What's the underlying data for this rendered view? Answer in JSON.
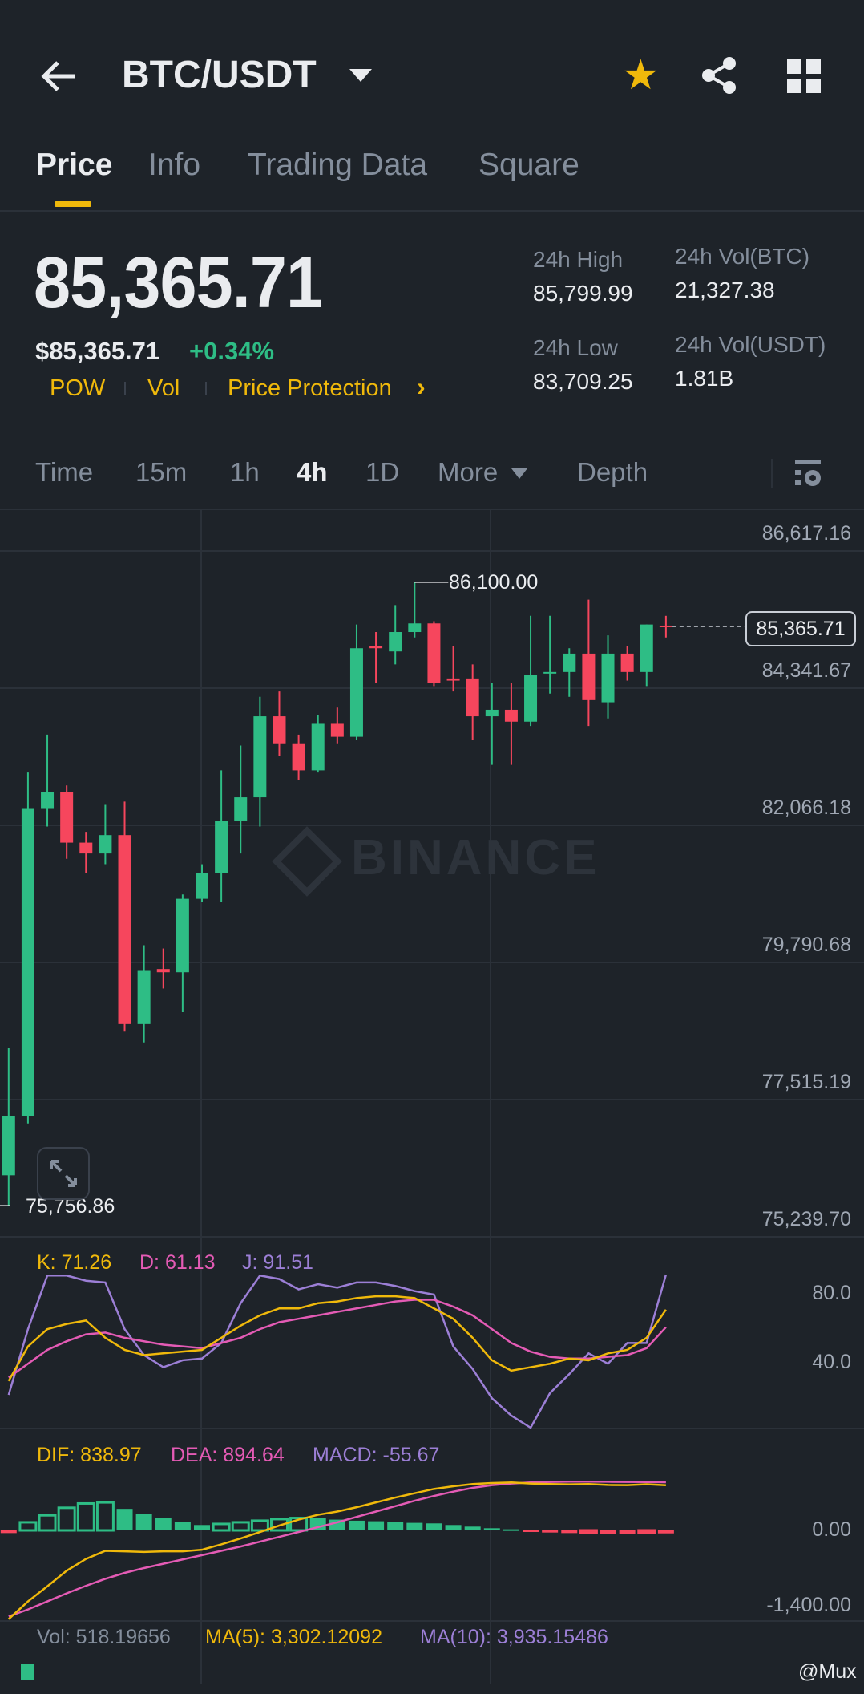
{
  "header": {
    "title": "BTC/USDT",
    "icons": [
      "back-arrow-icon",
      "caret-down-icon",
      "star-icon",
      "share-icon",
      "grid-icon"
    ]
  },
  "tabs": [
    {
      "label": "Price",
      "active": true
    },
    {
      "label": "Info"
    },
    {
      "label": "Trading Data"
    },
    {
      "label": "Square"
    }
  ],
  "ticker": {
    "last_price": "85,365.71",
    "usd_price": "$85,365.71",
    "change": "+0.34%",
    "tags": [
      "POW",
      "Vol",
      "Price Protection"
    ],
    "stats": [
      {
        "label": "24h High",
        "value": "85,799.99"
      },
      {
        "label": "24h Vol(BTC)",
        "value": "21,327.38"
      },
      {
        "label": "24h Low",
        "value": "83,709.25"
      },
      {
        "label": "24h Vol(USDT)",
        "value": "1.81B"
      }
    ]
  },
  "intervals": {
    "items": [
      "Time",
      "15m",
      "1h",
      "4h",
      "1D",
      "More",
      "Depth"
    ],
    "active": "4h"
  },
  "colors": {
    "up": "#2ebd85",
    "down": "#f6465d",
    "accent": "#f0b90b",
    "k": "#f0b90b",
    "d": "#e45bb5",
    "j": "#9c7fd6"
  },
  "watermark": "BINANCE",
  "credit": "@Mux",
  "chart_data": {
    "type": "candlestick",
    "interval": "4h",
    "price_axis": [
      "86,617.16",
      "84,341.67",
      "82,066.18",
      "79,790.68",
      "77,515.19",
      "75,239.70"
    ],
    "price_range": [
      75239.7,
      86617.16
    ],
    "current_price": 85365.71,
    "current_price_label": "85,365.71",
    "high_marker": {
      "value": 86100.0,
      "label": "86,100.00",
      "index": 21
    },
    "low_marker": {
      "value": 75756.86,
      "label": "75,756.86",
      "index": 0
    },
    "candles": [
      [
        76260,
        78374,
        75757,
        77245
      ],
      [
        77245,
        82943,
        77120,
        82352
      ],
      [
        82352,
        83571,
        82047,
        82620
      ],
      [
        82620,
        82728,
        81510,
        81779
      ],
      [
        81779,
        81958,
        81277,
        81599
      ],
      [
        81599,
        82406,
        81420,
        81904
      ],
      [
        81904,
        82460,
        78643,
        78768
      ],
      [
        78768,
        80076,
        78463,
        79664
      ],
      [
        79682,
        80023,
        79359,
        79628
      ],
      [
        79628,
        80918,
        78965,
        80847
      ],
      [
        80847,
        81420,
        80793,
        81277
      ],
      [
        81277,
        82979,
        80793,
        82137
      ],
      [
        82137,
        83391,
        81599,
        82531
      ],
      [
        82531,
        84198,
        82047,
        83875
      ],
      [
        83875,
        84287,
        83212,
        83427
      ],
      [
        83427,
        83571,
        82818,
        82979
      ],
      [
        82979,
        83893,
        82943,
        83750
      ],
      [
        83750,
        84019,
        83427,
        83535
      ],
      [
        83535,
        85398,
        83481,
        85004
      ],
      [
        85040,
        85273,
        84431,
        85004
      ],
      [
        84951,
        85721,
        84736,
        85273
      ],
      [
        85273,
        86100,
        85183,
        85416
      ],
      [
        85416,
        85452,
        84377,
        84431
      ],
      [
        84503,
        85040,
        84287,
        84467
      ],
      [
        84503,
        84736,
        83481,
        83875
      ],
      [
        83875,
        84431,
        83069,
        83983
      ],
      [
        83983,
        84431,
        83069,
        83786
      ],
      [
        83786,
        85542,
        83714,
        84556
      ],
      [
        84592,
        85542,
        84252,
        84610
      ],
      [
        84610,
        85004,
        84198,
        84915
      ],
      [
        84915,
        85811,
        83714,
        84144
      ],
      [
        84108,
        85219,
        83839,
        84915
      ],
      [
        84915,
        85040,
        84467,
        84610
      ],
      [
        84610,
        85398,
        84377,
        85398
      ],
      [
        85380,
        85542,
        85183,
        85365.71
      ]
    ],
    "kdj": {
      "labels": {
        "k": "K: 71.26",
        "d": "D: 61.13",
        "j": "J: 91.51"
      },
      "axis": [
        "80.0",
        "40.0"
      ],
      "k": [
        30,
        50,
        60,
        63,
        65,
        55,
        48,
        45,
        46,
        47,
        48,
        55,
        62,
        68,
        72,
        72,
        75,
        76,
        78,
        79,
        79,
        78,
        72,
        66,
        55,
        42,
        36,
        38,
        40,
        43,
        42,
        46,
        48,
        55,
        71.26
      ],
      "d": [
        32,
        40,
        48,
        53,
        57,
        58,
        55,
        53,
        51,
        50,
        49,
        52,
        55,
        60,
        64,
        66,
        68,
        70,
        72,
        74,
        76,
        77,
        77,
        73,
        68,
        60,
        52,
        47,
        44,
        43,
        43,
        44,
        45,
        49,
        61.13
      ],
      "j": [
        22,
        60,
        91,
        91,
        88,
        87,
        60,
        45,
        38,
        42,
        43,
        52,
        75,
        91,
        89,
        83,
        86,
        84,
        87,
        87,
        85,
        82,
        80,
        50,
        37,
        20,
        10,
        3,
        23,
        34,
        46,
        40,
        52,
        52,
        91.51
      ]
    },
    "macd": {
      "labels": {
        "dif": "DIF: 838.97",
        "dea": "DEA: 894.64",
        "macd": "MACD: -55.67"
      },
      "axis": [
        "0.00",
        "-1,400.00"
      ],
      "dif": [
        -1650,
        -1320,
        -1040,
        -750,
        -530,
        -380,
        -390,
        -400,
        -390,
        -390,
        -360,
        -260,
        -150,
        -30,
        90,
        200,
        290,
        350,
        430,
        520,
        610,
        690,
        770,
        820,
        860,
        880,
        890,
        870,
        860,
        855,
        860,
        843,
        840,
        857,
        838.97
      ],
      "dea": [
        -1600,
        -1470,
        -1320,
        -1170,
        -1030,
        -900,
        -790,
        -700,
        -620,
        -540,
        -460,
        -380,
        -300,
        -210,
        -120,
        -30,
        60,
        150,
        250,
        350,
        450,
        550,
        640,
        720,
        790,
        840,
        870,
        890,
        900,
        905,
        905,
        903,
        900,
        897,
        894.64
      ],
      "hist": [
        -50,
        150,
        280,
        420,
        500,
        520,
        400,
        300,
        230,
        150,
        100,
        120,
        150,
        180,
        210,
        230,
        230,
        200,
        180,
        170,
        160,
        140,
        130,
        100,
        70,
        40,
        20,
        -20,
        -40,
        -50,
        -45,
        -60,
        -60,
        -40,
        -55.67
      ]
    },
    "volume": {
      "labels": {
        "vol": "Vol: 518.19656",
        "ma5": "MA(5): 3,302.12092",
        "ma10": "MA(10): 3,935.15486"
      }
    }
  }
}
